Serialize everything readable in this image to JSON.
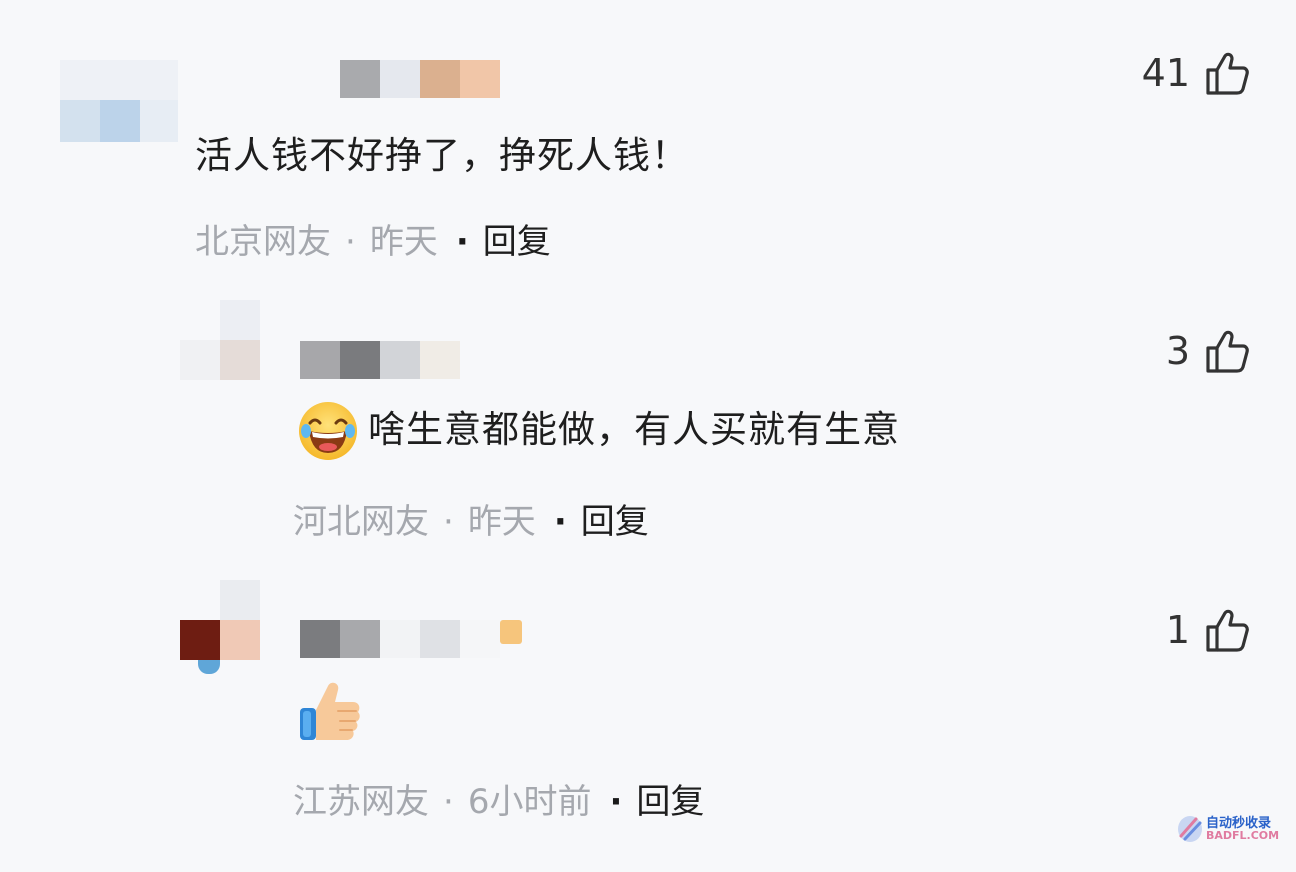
{
  "comments": [
    {
      "text": "活人钱不好挣了，挣死人钱！",
      "location": "北京网友",
      "time": "昨天",
      "reply_label": "回复",
      "likes": "41",
      "meta_sep": "·"
    },
    {
      "text": "啥生意都能做，有人买就有生意",
      "emoji": "grinning-squinting-face-emoji",
      "location": "河北网友",
      "time": "昨天",
      "reply_label": "回复",
      "likes": "3",
      "meta_sep": "·"
    },
    {
      "text": "",
      "emoji": "thumbs-up-emoji",
      "location": "江苏网友",
      "time": "6小时前",
      "reply_label": "回复",
      "likes": "1",
      "meta_sep": "·"
    }
  ],
  "watermark": {
    "line1": "自动秒收录",
    "line2": "BADFL.COM"
  },
  "colors": {
    "background": "#f7f8fa",
    "meta_gray": "#a5a8ae",
    "text_dark": "#1e1e1e"
  }
}
